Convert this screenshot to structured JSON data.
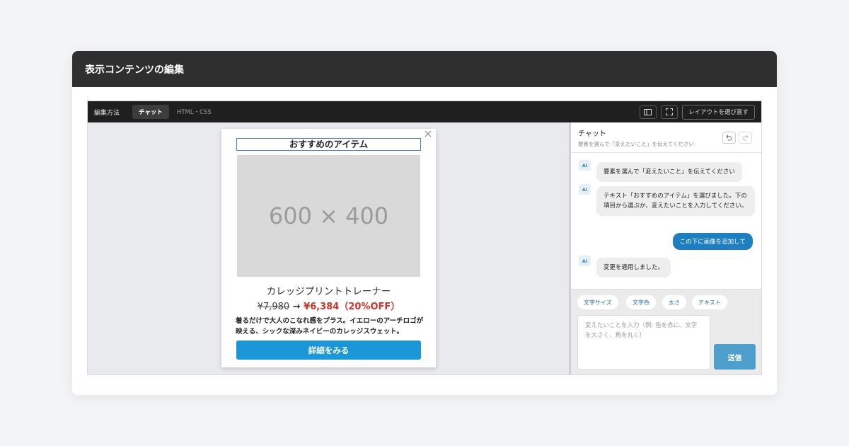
{
  "modal": {
    "title": "表示コンテンツの編集"
  },
  "toolbar": {
    "label": "編集方法",
    "tabs": [
      {
        "label": "チャット",
        "active": true
      },
      {
        "label": "HTML・CSS",
        "active": false
      }
    ],
    "icons": [
      "panel-icon",
      "fullscreen-icon"
    ],
    "relayout_label": "レイアウトを選び直す"
  },
  "card": {
    "heading": "おすすめのアイテム",
    "image_placeholder": "600 × 400",
    "product_name": "カレッジプリントトレーナー",
    "price_old": "¥7,980",
    "price_arrow": "→",
    "price_new": "¥6,384（20%OFF）",
    "description": "着るだけで大人のこなれ感をプラス。イエローのアーチロゴが映える、シックな深みネイビーのカレッジスウェット。",
    "cta_label": "詳細をみる"
  },
  "chat": {
    "title": "チャット",
    "subtitle": "要素を選んで「変えたいこと」を伝えてください",
    "ai_badge": "AI",
    "messages": [
      {
        "role": "ai",
        "text": "要素を選んで「変えたいこと」を伝えてください"
      },
      {
        "role": "ai",
        "text": "テキスト「おすすめのアイテム」を選びました。下の項目から選ぶか、変えたいことを入力してください。"
      },
      {
        "role": "user",
        "text": "この下に画像を追加して"
      },
      {
        "role": "ai",
        "text": "変更を適用しました。"
      }
    ],
    "chips": [
      "文字サイズ",
      "文字色",
      "太さ",
      "テキスト"
    ],
    "input_placeholder": "変えたいことを入力（例: 色を赤に、文字を大さく、角を丸く）",
    "send_label": "送信"
  },
  "colors": {
    "accent": "#1a97d4",
    "user_bubble": "#1d7ec0",
    "sale_price": "#d0342c",
    "header_bg": "#2f2f2f",
    "toolbar_bg": "#1f1f1f"
  }
}
